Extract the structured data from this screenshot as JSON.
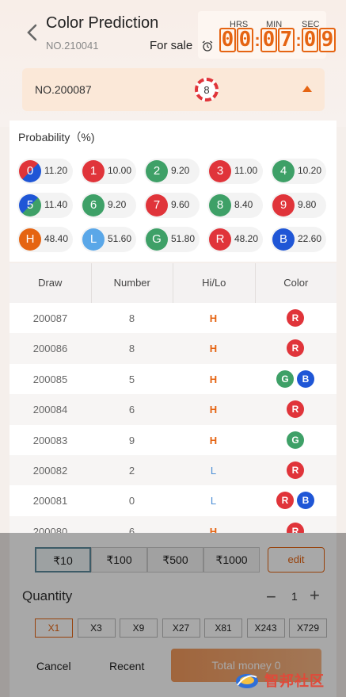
{
  "header": {
    "title": "Color Prediction",
    "period_no": "NO.210041",
    "for_sale": "For sale",
    "timer": {
      "hrs_label": "HRS",
      "min_label": "MIN",
      "sec_label": "SEC",
      "digits": [
        "0",
        "0",
        "0",
        "7",
        "0",
        "9"
      ]
    }
  },
  "draw_bar": {
    "no": "NO.200087",
    "ball": "8"
  },
  "probability": {
    "title": "Probability（%)",
    "items": [
      {
        "label": "0",
        "value": "11.20",
        "color": "split-red-blue"
      },
      {
        "label": "1",
        "value": "10.00",
        "color": "#e0343a"
      },
      {
        "label": "2",
        "value": "9.20",
        "color": "#3ea067"
      },
      {
        "label": "3",
        "value": "11.00",
        "color": "#e0343a"
      },
      {
        "label": "4",
        "value": "10.20",
        "color": "#3ea067"
      },
      {
        "label": "5",
        "value": "11.40",
        "color": "split-green-blue"
      },
      {
        "label": "6",
        "value": "9.20",
        "color": "#3ea067"
      },
      {
        "label": "7",
        "value": "9.60",
        "color": "#e0343a"
      },
      {
        "label": "8",
        "value": "8.40",
        "color": "#3ea067"
      },
      {
        "label": "9",
        "value": "9.80",
        "color": "#e0343a"
      },
      {
        "label": "H",
        "value": "48.40",
        "color": "#e56412"
      },
      {
        "label": "L",
        "value": "51.60",
        "color": "#5aa7e8"
      },
      {
        "label": "G",
        "value": "51.80",
        "color": "#3ea067"
      },
      {
        "label": "R",
        "value": "48.20",
        "color": "#e0343a"
      },
      {
        "label": "B",
        "value": "22.60",
        "color": "#1f56d6"
      }
    ]
  },
  "table": {
    "headers": [
      "Draw",
      "Number",
      "Hi/Lo",
      "Color"
    ],
    "rows": [
      {
        "draw": "200087",
        "number": "8",
        "hilo": "H",
        "colors": [
          "R"
        ]
      },
      {
        "draw": "200086",
        "number": "8",
        "hilo": "H",
        "colors": [
          "R"
        ]
      },
      {
        "draw": "200085",
        "number": "5",
        "hilo": "H",
        "colors": [
          "G",
          "B"
        ]
      },
      {
        "draw": "200084",
        "number": "6",
        "hilo": "H",
        "colors": [
          "R"
        ]
      },
      {
        "draw": "200083",
        "number": "9",
        "hilo": "H",
        "colors": [
          "G"
        ]
      },
      {
        "draw": "200082",
        "number": "2",
        "hilo": "L",
        "colors": [
          "R"
        ]
      },
      {
        "draw": "200081",
        "number": "0",
        "hilo": "L",
        "colors": [
          "R",
          "B"
        ]
      },
      {
        "draw": "200080",
        "number": "6",
        "hilo": "H",
        "colors": [
          "R"
        ]
      }
    ]
  },
  "bet": {
    "amounts": [
      "₹10",
      "₹100",
      "₹500",
      "₹1000"
    ],
    "selected_amount": 0,
    "edit_label": "edit",
    "quantity_label": "Quantity",
    "quantity_value": "1",
    "minus": "−",
    "plus": "+",
    "multipliers": [
      "X1",
      "X3",
      "X9",
      "X27",
      "X81",
      "X243",
      "X729"
    ],
    "selected_multiplier": 0,
    "cancel_label": "Cancel",
    "recent_label": "Recent",
    "total_label": "Total money 0"
  },
  "watermark": {
    "text": "智邦社区"
  },
  "colors": {
    "accent": "#e56412",
    "red": "#e0343a",
    "green": "#3ea067",
    "blue": "#1f56d6"
  }
}
